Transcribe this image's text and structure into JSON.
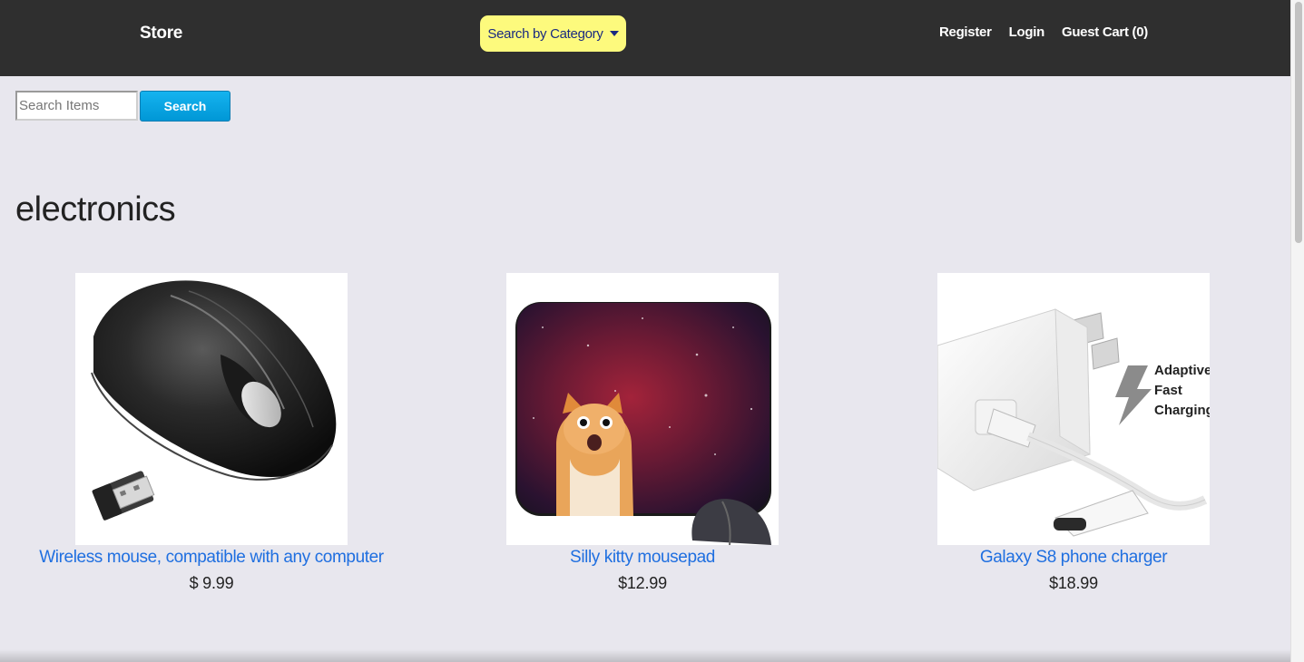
{
  "navbar": {
    "brand": "Store",
    "category_button": "Search by Category",
    "links": [
      "Register",
      "Login",
      "Guest Cart (0)"
    ]
  },
  "search": {
    "placeholder": "Search Items",
    "button_label": "Search"
  },
  "category": {
    "title": "electronics"
  },
  "products": [
    {
      "name": "Wireless mouse, compatible with any computer",
      "price": "$ 9.99",
      "image": "wireless-mouse-image"
    },
    {
      "name": "Silly kitty mousepad",
      "price": "$12.99",
      "image": "cat-space-mousepad-image"
    },
    {
      "name": "Galaxy S8 phone charger",
      "price": "$18.99",
      "image": "phone-charger-image",
      "image_text": [
        "Adaptive",
        "Fast",
        "Charging"
      ]
    }
  ],
  "colors": {
    "navbar_bg": "#2f2f2f",
    "page_bg": "#e8e7ee",
    "category_button_bg": "#fdfa7d",
    "search_button_bg": "#0fa6e6",
    "link_color": "#1f6fe0"
  }
}
